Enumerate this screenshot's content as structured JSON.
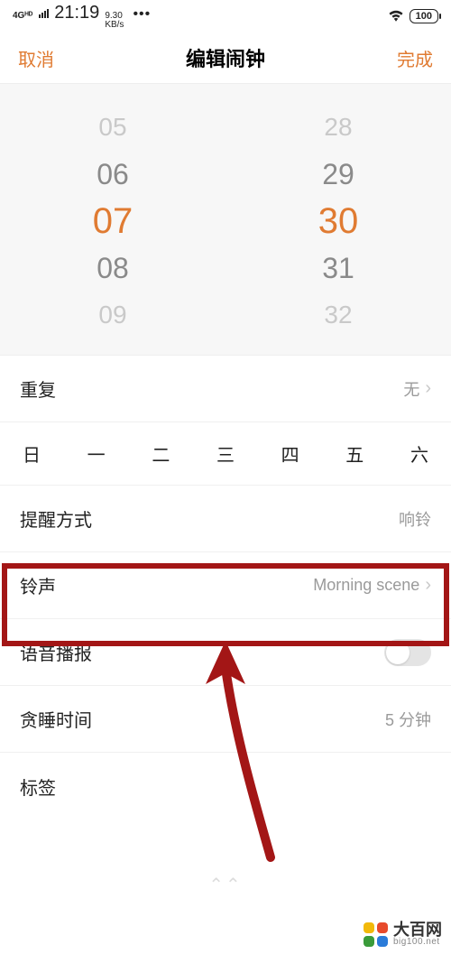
{
  "status": {
    "network_badge": "4Gᴴᴰ",
    "time": "21:19",
    "speed_top": "9.30",
    "speed_bot": "KB/s",
    "dots": "•••",
    "battery": "100"
  },
  "nav": {
    "cancel": "取消",
    "title": "编辑闹钟",
    "done": "完成"
  },
  "picker": {
    "hours": [
      "05",
      "06",
      "07",
      "08",
      "09"
    ],
    "minutes": [
      "28",
      "29",
      "30",
      "31",
      "32"
    ]
  },
  "rows": {
    "repeat": {
      "label": "重复",
      "value": "无"
    },
    "days": [
      "日",
      "一",
      "二",
      "三",
      "四",
      "五",
      "六"
    ],
    "remind": {
      "label": "提醒方式",
      "value": "响铃"
    },
    "ringtone": {
      "label": "铃声",
      "value": "Morning scene"
    },
    "voice": {
      "label": "语音播报"
    },
    "snooze": {
      "label": "贪睡时间",
      "value": "5 分钟"
    },
    "tag": {
      "label": "标签"
    }
  },
  "watermark": {
    "main": "大百网",
    "sub": "big100.net"
  },
  "colors": {
    "accent": "#e07b32",
    "annotation": "#a31616"
  }
}
